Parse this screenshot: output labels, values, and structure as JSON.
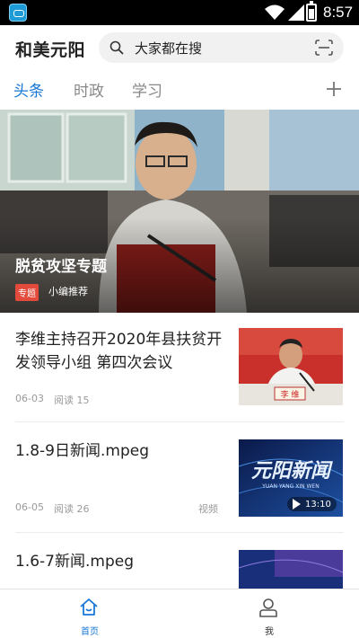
{
  "status_bar": {
    "time": "8:57",
    "icons": [
      "app-notification-icon",
      "wifi-icon",
      "signal-icon",
      "battery-icon"
    ]
  },
  "header": {
    "title": "和美元阳",
    "search_text": "大家都在搜",
    "search_icon": "search-icon",
    "scan_icon": "scan-icon"
  },
  "tabs": {
    "items": [
      {
        "label": "头条",
        "active": true
      },
      {
        "label": "时政",
        "active": false
      },
      {
        "label": "学习",
        "active": false
      }
    ],
    "add_icon": "plus-icon"
  },
  "banner": {
    "title": "脱贫攻坚专题",
    "tag": "专题",
    "subtitle": "小编推荐"
  },
  "news": [
    {
      "title": "李维主持召开2020年县扶贫开发领导小组 第四次会议",
      "date": "06-03",
      "reads": "阅读 15",
      "type": ""
    },
    {
      "title": "1.8-9日新闻.mpeg",
      "date": "06-05",
      "reads": "阅读 26",
      "type": "视频",
      "duration": "13:10",
      "thumb_text": "元阳新闻",
      "thumb_subtext": "YUAN YANG XIN WEN"
    },
    {
      "title": "1.6-7新闻.mpeg"
    }
  ],
  "thumb1_nameplate": "李 维",
  "bottom_nav": {
    "items": [
      {
        "label": "首页",
        "icon": "home-icon",
        "active": true
      },
      {
        "label": "我",
        "icon": "user-icon",
        "active": false
      }
    ]
  },
  "colors": {
    "accent": "#1778d6",
    "tag_red": "#e34a3b",
    "text": "#222222",
    "meta": "#9a9a9a"
  }
}
